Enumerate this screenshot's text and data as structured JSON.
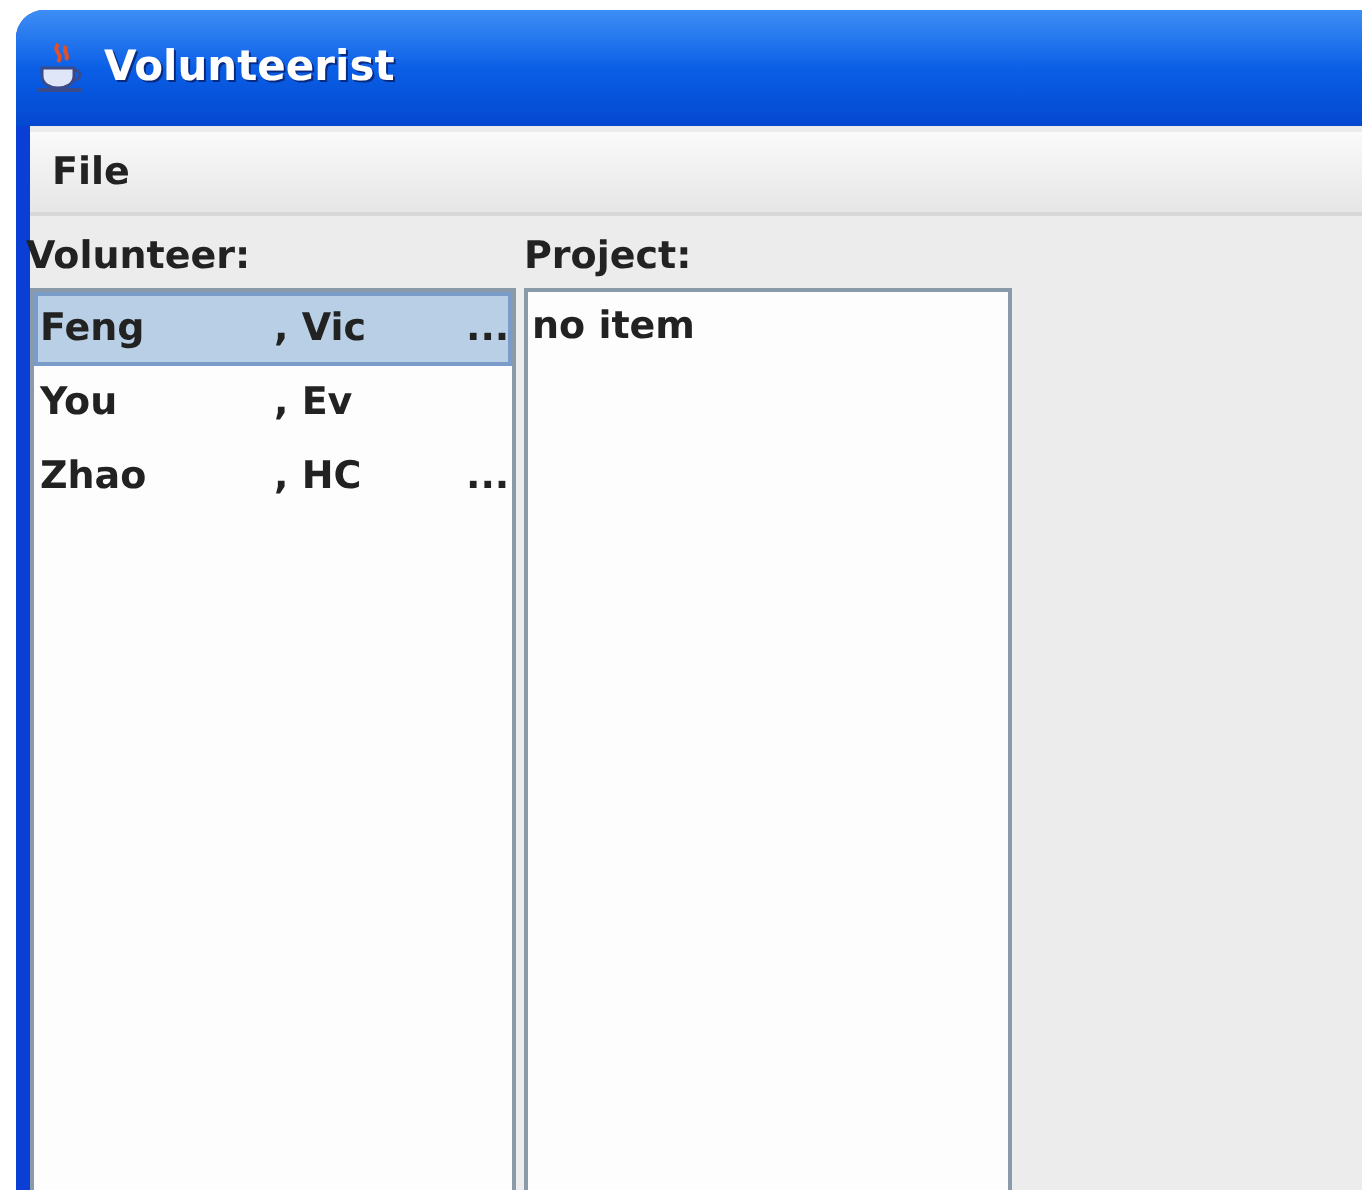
{
  "window": {
    "title": "Volunteerist"
  },
  "menu": [
    "File"
  ],
  "volunteer_list": {
    "label": "Volunteer:",
    "items": [
      {
        "last": "Feng",
        "first": ", Vic",
        "more": "...",
        "selected": true
      },
      {
        "last": "You",
        "first": ", Ev",
        "selected": false
      },
      {
        "last": "Zhao",
        "first": ", HC",
        "more": "...",
        "selected": false
      }
    ]
  },
  "project_list": {
    "label": "Project:",
    "items": [
      "no item"
    ]
  }
}
